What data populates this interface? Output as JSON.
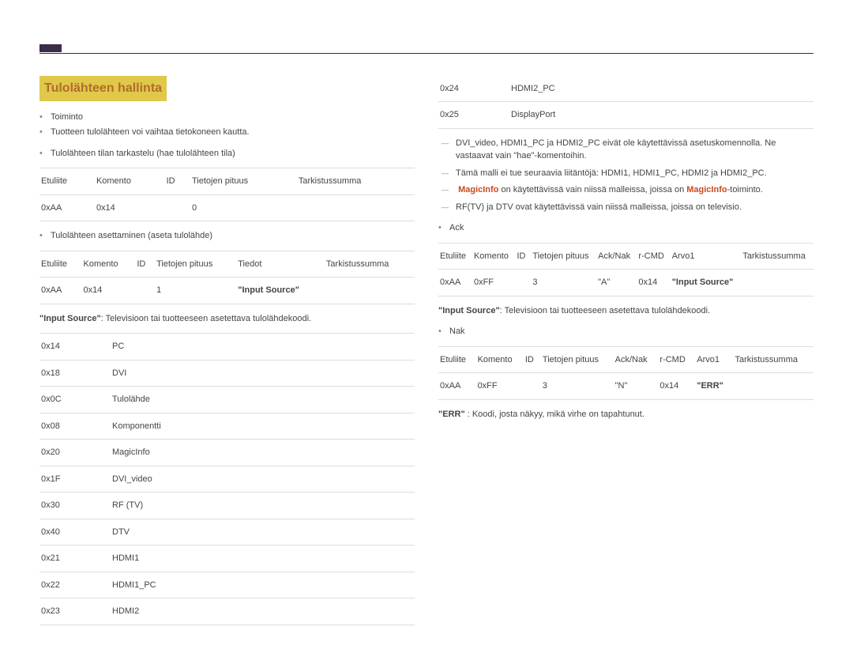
{
  "title": "Tulolähteen hallinta",
  "left": {
    "bullets1": [
      "Toiminto",
      "Tuotteen tulolähteen voi vaihtaa tietokoneen kautta."
    ],
    "bullets2": [
      "Tulolähteen tilan tarkastelu (hae tulolähteen tila)"
    ],
    "table1": {
      "headers": [
        "Etuliite",
        "Komento",
        "ID",
        "Tietojen pituus",
        "Tarkistussumma"
      ],
      "row": [
        "0xAA",
        "0x14",
        "",
        "0",
        ""
      ]
    },
    "bullets3": [
      "Tulolähteen asettaminen (aseta tulolähde)"
    ],
    "table2": {
      "headers": [
        "Etuliite",
        "Komento",
        "ID",
        "Tietojen pituus",
        "Tiedot",
        "Tarkistussumma"
      ],
      "row": [
        "0xAA",
        "0x14",
        "",
        "1",
        "\"Input Source\"",
        ""
      ]
    },
    "desc_prefix": "\"Input Source\"",
    "desc_text": ": Televisioon tai tuotteeseen asetettava tulolähdekoodi.",
    "codes": [
      [
        "0x14",
        "PC"
      ],
      [
        "0x18",
        "DVI"
      ],
      [
        "0x0C",
        "Tulolähde"
      ],
      [
        "0x08",
        "Komponentti"
      ],
      [
        "0x20",
        "MagicInfo"
      ],
      [
        "0x1F",
        "DVI_video"
      ],
      [
        "0x30",
        "RF (TV)"
      ],
      [
        "0x40",
        "DTV"
      ],
      [
        "0x21",
        "HDMI1"
      ],
      [
        "0x22",
        "HDMI1_PC"
      ],
      [
        "0x23",
        "HDMI2"
      ]
    ]
  },
  "right": {
    "codes_cont": [
      [
        "0x24",
        "HDMI2_PC"
      ],
      [
        "0x25",
        "DisplayPort"
      ]
    ],
    "dash1": "DVI_video, HDMI1_PC ja HDMI2_PC eivät ole käytettävissä asetuskomennolla. Ne vastaavat vain \"hae\"-komentoihin.",
    "dash2": "Tämä malli ei tue seuraavia liitäntöjä: HDMI1, HDMI1_PC, HDMI2 ja HDMI2_PC.",
    "dash3_p1": "MagicInfo",
    "dash3_p2": " on käytettävissä vain niissä malleissa, joissa on ",
    "dash3_p3": "MagicInfo",
    "dash3_p4": "-toiminto.",
    "dash4": "RF(TV) ja DTV ovat käytettävissä vain niissä malleissa, joissa on televisio.",
    "ack_bullet": "Ack",
    "tableA": {
      "headers": [
        "Etuliite",
        "Komento",
        "ID",
        "Tietojen pituus",
        "Ack/Nak",
        "r-CMD",
        "Arvo1",
        "Tarkistussumma"
      ],
      "row": [
        "0xAA",
        "0xFF",
        "",
        "3",
        "\"A\"",
        "0x14",
        "\"Input Source\"",
        ""
      ]
    },
    "desc2_prefix": "\"Input Source\"",
    "desc2_text": ": Televisioon tai tuotteeseen asetettava tulolähdekoodi.",
    "nak_bullet": "Nak",
    "tableB": {
      "headers": [
        "Etuliite",
        "Komento",
        "ID",
        "Tietojen pituus",
        "Ack/Nak",
        "r-CMD",
        "Arvo1",
        "Tarkistussumma"
      ],
      "row": [
        "0xAA",
        "0xFF",
        "",
        "3",
        "\"N\"",
        "0x14",
        "\"ERR\"",
        ""
      ]
    },
    "err_prefix": "\"ERR\"",
    "err_text": " : Koodi, josta näkyy, mikä virhe on tapahtunut."
  }
}
